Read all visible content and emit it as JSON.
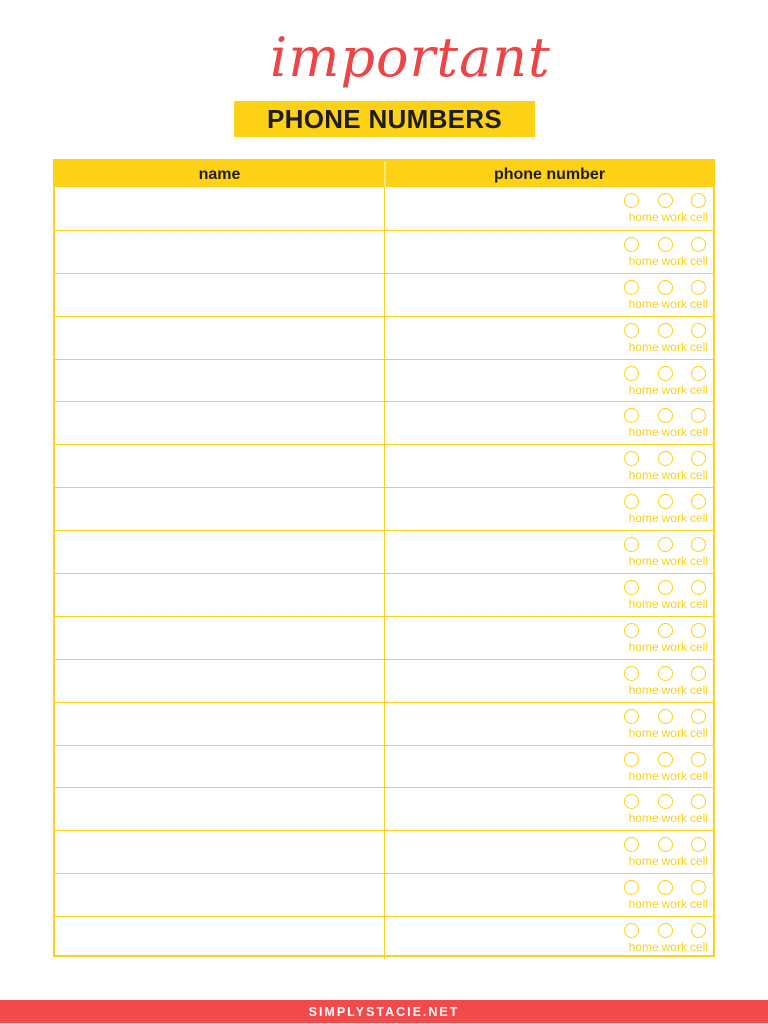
{
  "header": {
    "script_title": "important",
    "banner_title": "PHONE NUMBERS"
  },
  "table": {
    "columns": [
      "name",
      "phone number"
    ],
    "row_count": 18,
    "phone_types": [
      "home",
      "work",
      "cell"
    ],
    "rows": [
      {
        "name": "",
        "phone": ""
      },
      {
        "name": "",
        "phone": ""
      },
      {
        "name": "",
        "phone": ""
      },
      {
        "name": "",
        "phone": ""
      },
      {
        "name": "",
        "phone": ""
      },
      {
        "name": "",
        "phone": ""
      },
      {
        "name": "",
        "phone": ""
      },
      {
        "name": "",
        "phone": ""
      },
      {
        "name": "",
        "phone": ""
      },
      {
        "name": "",
        "phone": ""
      },
      {
        "name": "",
        "phone": ""
      },
      {
        "name": "",
        "phone": ""
      },
      {
        "name": "",
        "phone": ""
      },
      {
        "name": "",
        "phone": ""
      },
      {
        "name": "",
        "phone": ""
      },
      {
        "name": "",
        "phone": ""
      },
      {
        "name": "",
        "phone": ""
      },
      {
        "name": "",
        "phone": ""
      }
    ]
  },
  "footer": {
    "site": "SIMPLYSTACIE.NET"
  },
  "colors": {
    "accent_yellow": "#fcd116",
    "accent_red": "#ee4446",
    "footer_red": "#f04a4a",
    "text_dark": "#1d1d1d"
  }
}
